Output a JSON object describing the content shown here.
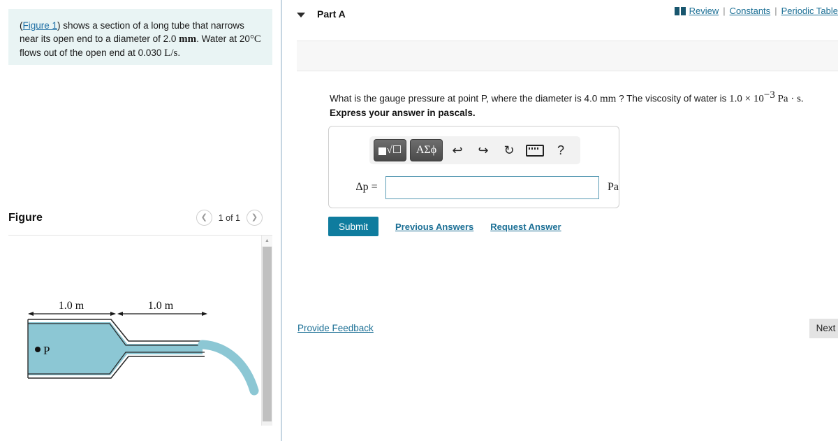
{
  "topbar": {
    "book_icon": "book-icon",
    "review": "Review",
    "separator": "|",
    "constants": "Constants",
    "periodic_table": "Periodic Table"
  },
  "problem": {
    "figure_link": "Figure 1",
    "text_before": ") shows a section of a long tube that narrows near its open end to a diameter of 2.0 ",
    "unit_mm": "mm",
    "text_mid": ". Water at 20",
    "deg_c": "°C",
    "text_after": " flows out of the open end at 0.030 ",
    "unit_ls": "L/s",
    "period": "."
  },
  "figure_panel": {
    "title": "Figure",
    "prev_icon": "❮",
    "next_icon": "❯",
    "counter": "1 of 1",
    "scroll_up_icon": "▲",
    "diagram": {
      "dim_label_left": "1.0 m",
      "dim_label_right": "1.0 m",
      "point_label": "P",
      "water_color": "#8cc7d4",
      "wall_color": "#2a2a2a"
    }
  },
  "part": {
    "caret_icon": "chevron-down-icon",
    "label": "Part A",
    "question_1": "What is the gauge pressure at point P, where the diameter is 4.0 ",
    "question_mm": "mm",
    "question_2": " ? The viscosity of water is ",
    "viscosity_value": "1.0 × 10",
    "viscosity_exp": "−3",
    "viscosity_unit": " Pa · s.",
    "instruction": "Express your answer in pascals."
  },
  "answer": {
    "toolbar": {
      "template_button": "template-button",
      "root_glyph": "√☐",
      "greek_button": "ΑΣϕ",
      "undo_icon": "↩",
      "redo_icon": "↪",
      "reset_icon": "↻",
      "keyboard_icon": "keyboard-icon",
      "help_icon": "?"
    },
    "variable_label": "Δp =",
    "input_value": "",
    "input_placeholder": "",
    "unit": "Pa"
  },
  "actions": {
    "submit": "Submit",
    "previous_answers": "Previous Answers",
    "request_answer": "Request Answer",
    "provide_feedback": "Provide Feedback",
    "next": "Next ❯"
  },
  "colors": {
    "accent_teal": "#0f7c9e",
    "link_blue": "#1b6f95",
    "statement_bg": "#e9f4f4",
    "water": "#8cc7d4"
  }
}
